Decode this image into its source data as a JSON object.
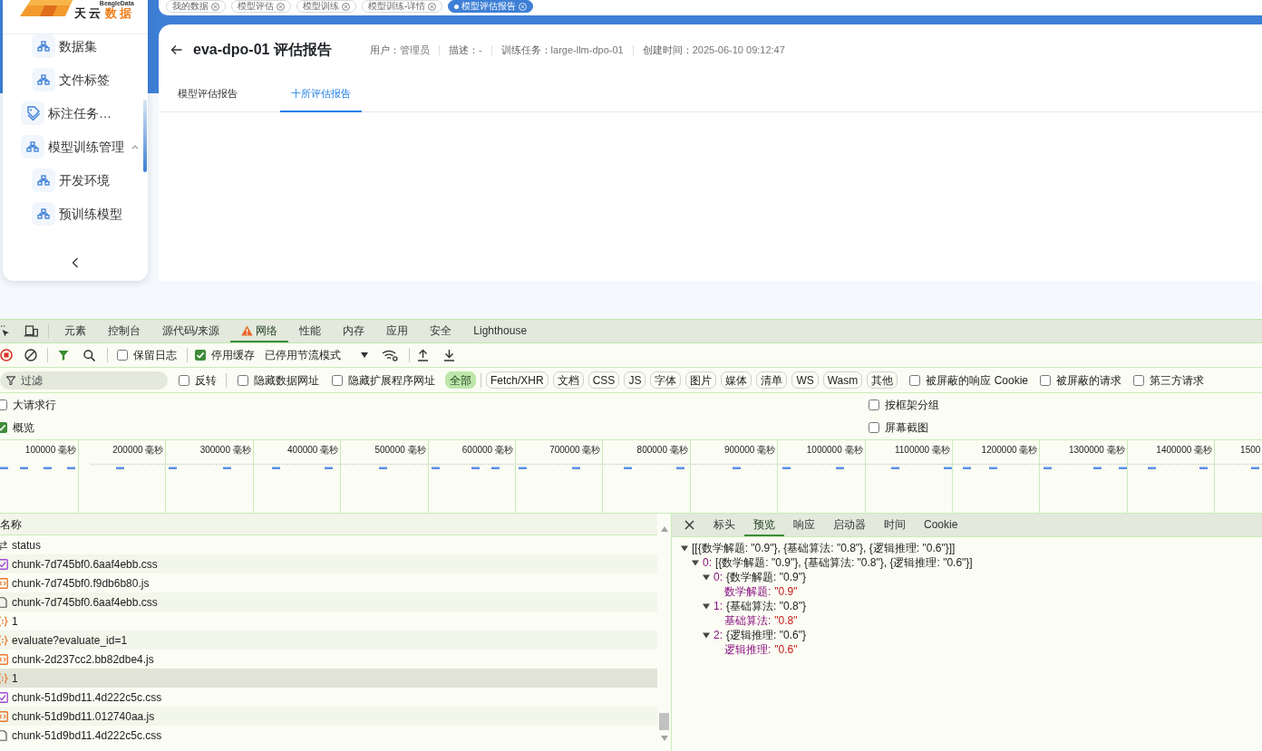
{
  "sidebar": {
    "logo": {
      "tagline": "BeagleData",
      "name": "天云",
      "name_accent": "数据"
    },
    "continued_children": [
      {
        "label": "数据集"
      },
      {
        "label": "文件标签"
      }
    ],
    "items": [
      {
        "label": "标注任务…",
        "kind": "link"
      },
      {
        "label": "模型训练管理",
        "kind": "group",
        "expanded": true,
        "children": [
          {
            "label": "开发环境"
          },
          {
            "label": "预训练模型"
          }
        ]
      }
    ]
  },
  "open_tabs": [
    {
      "label": "我的数据",
      "selected": false
    },
    {
      "label": "模型评估",
      "selected": false
    },
    {
      "label": "模型训练",
      "selected": false
    },
    {
      "label": "模型训练-详情",
      "selected": false
    },
    {
      "label": "模型评估报告",
      "selected": true
    }
  ],
  "page": {
    "title": "eva-dpo-01 评估报告",
    "meta": [
      {
        "label": "用户：",
        "value": "管理员"
      },
      {
        "label": "描述：",
        "value": "-"
      },
      {
        "label": "训练任务：",
        "value": "large-llm-dpo-01"
      },
      {
        "label": "创建时间：",
        "value": "2025-06-10 09:12:47"
      }
    ],
    "tabs": [
      {
        "label": "模型评估报告",
        "selected": false
      },
      {
        "label": "十所评估报告",
        "selected": true
      }
    ]
  },
  "devtools": {
    "panel_tabs": [
      {
        "label": "元素",
        "selected": false,
        "warning": false
      },
      {
        "label": "控制台",
        "selected": false,
        "warning": false
      },
      {
        "label": "源代码/来源",
        "selected": false,
        "warning": false
      },
      {
        "label": "网络",
        "selected": true,
        "warning": true
      },
      {
        "label": "性能",
        "selected": false,
        "warning": false
      },
      {
        "label": "内存",
        "selected": false,
        "warning": false
      },
      {
        "label": "应用",
        "selected": false,
        "warning": false
      },
      {
        "label": "安全",
        "selected": false,
        "warning": false
      },
      {
        "label": "Lighthouse",
        "selected": false,
        "warning": false
      }
    ],
    "recording": true,
    "preserve_log": {
      "label": "保留日志",
      "checked": false
    },
    "disable_cache": {
      "label": "停用缓存",
      "checked": true
    },
    "throttling": "已停用节流模式",
    "filter": {
      "placeholder": "过滤"
    },
    "filter_options": [
      {
        "label": "反转",
        "checked": false
      },
      {
        "label": "隐藏数据网址",
        "checked": false
      },
      {
        "label": "隐藏扩展程序网址",
        "checked": false
      }
    ],
    "type_filters": [
      {
        "label": "全部",
        "selected": true
      },
      {
        "label": "Fetch/XHR",
        "selected": false
      },
      {
        "label": "文档",
        "selected": false
      },
      {
        "label": "CSS",
        "selected": false
      },
      {
        "label": "JS",
        "selected": false
      },
      {
        "label": "字体",
        "selected": false
      },
      {
        "label": "图片",
        "selected": false
      },
      {
        "label": "媒体",
        "selected": false
      },
      {
        "label": "清单",
        "selected": false
      },
      {
        "label": "WS",
        "selected": false
      },
      {
        "label": "Wasm",
        "selected": false
      },
      {
        "label": "其他",
        "selected": false
      }
    ],
    "blocked_options": [
      {
        "label": "被屏蔽的响应 Cookie",
        "checked": false
      },
      {
        "label": "被屏蔽的请求",
        "checked": false
      },
      {
        "label": "第三方请求",
        "checked": false
      }
    ],
    "settings_left": [
      {
        "label": "大请求行",
        "checked": false
      },
      {
        "label": "概览",
        "checked": true
      }
    ],
    "settings_right": [
      {
        "label": "按框架分组",
        "checked": false
      },
      {
        "label": "屏幕截图",
        "checked": false
      }
    ],
    "overview_ticks": [
      "100000 毫秒",
      "200000 毫秒",
      "300000 毫秒",
      "400000 毫秒",
      "500000 毫秒",
      "600000 毫秒",
      "700000 毫秒",
      "800000 毫秒",
      "900000 毫秒",
      "1000000 毫秒",
      "1100000 毫秒",
      "1200000 毫秒",
      "1300000 毫秒",
      "1400000 毫秒",
      "1500"
    ],
    "requests": {
      "column": "名称",
      "rows": [
        {
          "name": "status",
          "kind": "websocket",
          "selected": false
        },
        {
          "name": "chunk-7d745bf0.6aaf4ebb.css",
          "kind": "stylesheet",
          "selected": false
        },
        {
          "name": "chunk-7d745bf0.f9db6b80.js",
          "kind": "script",
          "selected": false
        },
        {
          "name": "chunk-7d745bf0.6aaf4ebb.css",
          "kind": "document",
          "selected": false
        },
        {
          "name": "1",
          "kind": "fetch",
          "selected": false
        },
        {
          "name": "evaluate?evaluate_id=1",
          "kind": "fetch",
          "selected": false
        },
        {
          "name": "chunk-2d237cc2.bb82dbe4.js",
          "kind": "script",
          "selected": false
        },
        {
          "name": "1",
          "kind": "fetch",
          "selected": true
        },
        {
          "name": "chunk-51d9bd11.4d222c5c.css",
          "kind": "stylesheet",
          "selected": false
        },
        {
          "name": "chunk-51d9bd11.012740aa.js",
          "kind": "script",
          "selected": false
        },
        {
          "name": "chunk-51d9bd11.4d222c5c.css",
          "kind": "document",
          "selected": false
        }
      ]
    },
    "details": {
      "tabs": [
        {
          "label": "标头",
          "selected": false
        },
        {
          "label": "预览",
          "selected": true
        },
        {
          "label": "响应",
          "selected": false
        },
        {
          "label": "启动器",
          "selected": false
        },
        {
          "label": "时间",
          "selected": false
        },
        {
          "label": "Cookie",
          "selected": false
        }
      ],
      "preview": [
        {
          "label": "[[{数学解题: \"0.9\"}, {基础算法: \"0.8\"}, {逻辑推理: \"0.6\"}]]",
          "expanded": true,
          "children": [
            {
              "key": "0:",
              "label": "[{数学解题: \"0.9\"}, {基础算法: \"0.8\"}, {逻辑推理: \"0.6\"}]",
              "expanded": true,
              "children": [
                {
                  "key": "0:",
                  "label": "{数学解题: \"0.9\"}",
                  "expanded": true,
                  "children": [
                    {
                      "key": "数学解题:",
                      "value": "\"0.9\""
                    }
                  ]
                },
                {
                  "key": "1:",
                  "label": "{基础算法: \"0.8\"}",
                  "expanded": true,
                  "children": [
                    {
                      "key": "基础算法:",
                      "value": "\"0.8\""
                    }
                  ]
                },
                {
                  "key": "2:",
                  "label": "{逻辑推理: \"0.6\"}",
                  "expanded": true,
                  "children": [
                    {
                      "key": "逻辑推理:",
                      "value": "\"0.6\""
                    }
                  ]
                }
              ]
            }
          ]
        }
      ]
    }
  }
}
